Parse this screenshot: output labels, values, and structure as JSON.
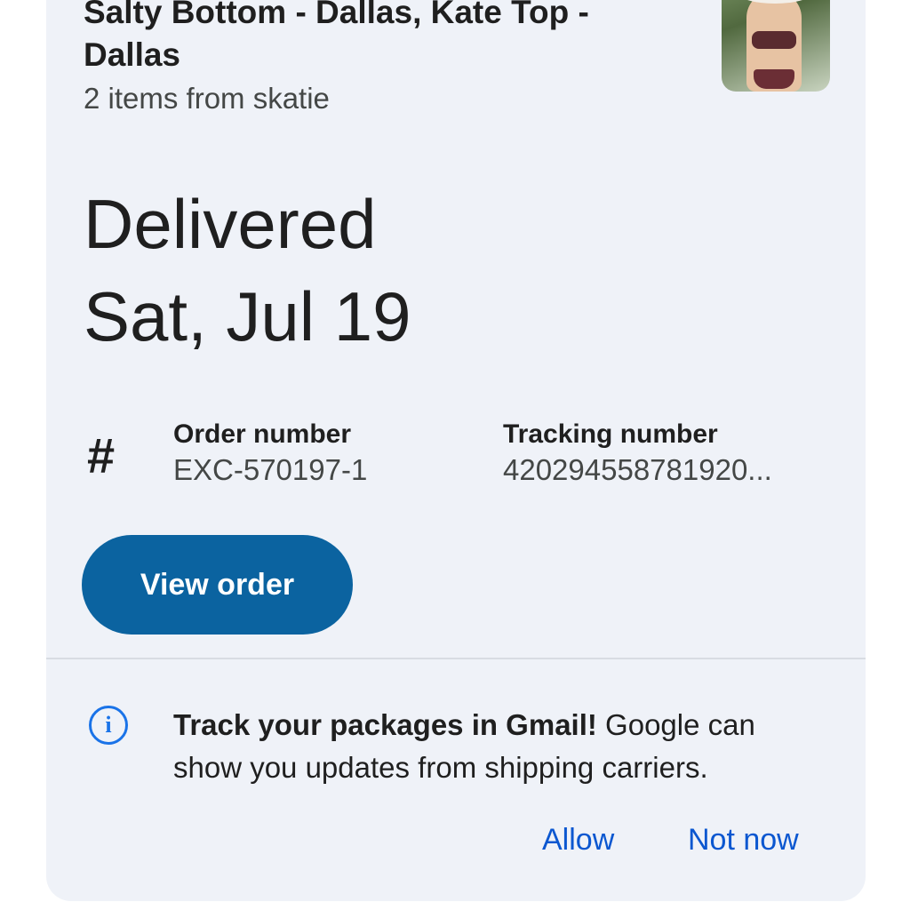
{
  "product": {
    "title": "Salty Bottom - Dallas, Kate Top - Dallas",
    "subtitle": "2 items from skatie"
  },
  "delivery": {
    "status": "Delivered",
    "date": "Sat, Jul 19"
  },
  "order": {
    "order_label": "Order number",
    "order_value": "EXC-570197-1",
    "tracking_label": "Tracking number",
    "tracking_value": "420294558781920...",
    "view_button": "View order"
  },
  "notice": {
    "bold_text": "Track your packages in Gmail!",
    "body_text": " Google can show you updates from shipping carriers.",
    "allow": "Allow",
    "not_now": "Not now"
  },
  "icons": {
    "hash": "hash-icon",
    "info": "info-icon"
  },
  "colors": {
    "card_background": "#eff2f8",
    "primary_button": "#0b63a0",
    "link": "#0b57d0",
    "info_icon": "#1a73e8"
  }
}
